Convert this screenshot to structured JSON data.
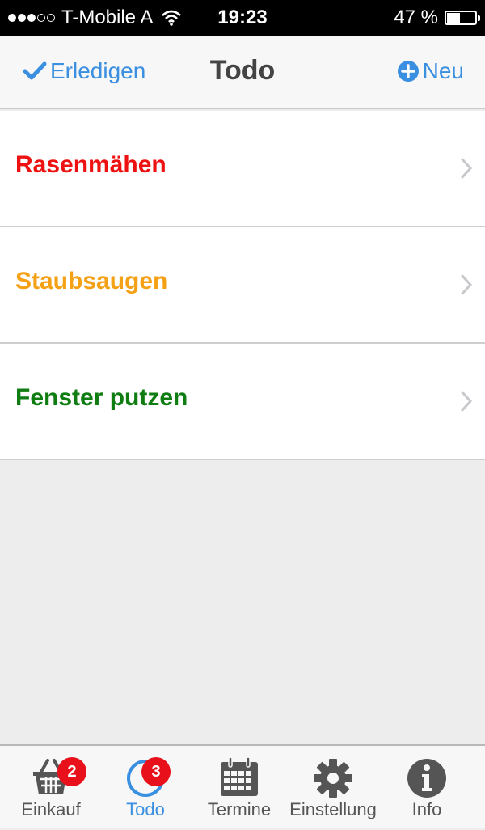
{
  "status": {
    "carrier": "T-Mobile A",
    "time": "19:23",
    "battery": "47 %",
    "battery_level": 0.47
  },
  "nav": {
    "left_label": "Erledigen",
    "title": "Todo",
    "right_label": "Neu"
  },
  "items": [
    {
      "label": "Rasenmähen",
      "color": "#ee1111"
    },
    {
      "label": "Staubsaugen",
      "color": "#f5a115"
    },
    {
      "label": "Fenster putzen",
      "color": "#0f7d12"
    }
  ],
  "tabs": [
    {
      "label": "Einkauf",
      "icon": "basket-icon",
      "badge": "2"
    },
    {
      "label": "Todo",
      "icon": "todo-ring-icon",
      "badge": "3",
      "active": true
    },
    {
      "label": "Termine",
      "icon": "calendar-icon"
    },
    {
      "label": "Einstellung",
      "icon": "gear-icon"
    },
    {
      "label": "Info",
      "icon": "info-icon"
    }
  ],
  "colors": {
    "accent": "#3a8fe0",
    "badge": "#e8101a"
  }
}
